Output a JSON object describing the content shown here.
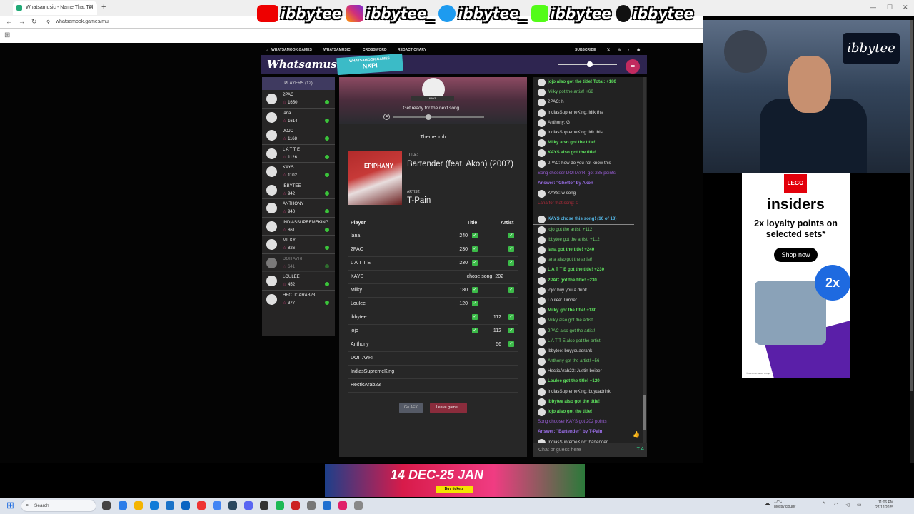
{
  "browser": {
    "tab_title": "Whatsamusic - Name That Tun",
    "url": "whatsamook.games/mu"
  },
  "overlay": {
    "handles": [
      "ibbytee",
      "ibbytee_",
      "ibbytee_",
      "ibbytee",
      "ibbytee"
    ],
    "cam_tag": "ibbytee"
  },
  "site": {
    "nav": [
      "WHATSAMOOK.GAMES",
      "WHATSAMUSIC",
      "CROSSWORD",
      "REDACTIONARY"
    ],
    "subscribe": "SUBSCRIBE",
    "logo": "Whatsamusic",
    "code_top": "WHATSAMOOK.GAMES",
    "code": "NXPI",
    "menu_icon": "hamburger-icon"
  },
  "players": {
    "header": "PLAYERS (12)",
    "list": [
      {
        "name": "2PAC",
        "score": "1650"
      },
      {
        "name": "lana",
        "score": "1614"
      },
      {
        "name": "JOJO",
        "score": "1168"
      },
      {
        "name": "L A T T E",
        "score": "1126"
      },
      {
        "name": "KAYS",
        "score": "1102"
      },
      {
        "name": "IBBYTEE",
        "score": "942"
      },
      {
        "name": "ANTHONY",
        "score": "940"
      },
      {
        "name": "INDIASSUPREMEKING",
        "score": "861"
      },
      {
        "name": "MILKY",
        "score": "826"
      },
      {
        "name": "DOITAYRI",
        "score": "641"
      },
      {
        "name": "LOULEE",
        "score": "452"
      },
      {
        "name": "HECTICARAB23",
        "score": "377"
      }
    ]
  },
  "game": {
    "chooser": "KAYS",
    "status": "Get ready for the next song...",
    "theme": "Theme: rnb",
    "title_label": "TITLE:",
    "title": "Bartender (feat. Akon) (2007)",
    "artist_label": "ARTIST:",
    "artist": "T-Pain",
    "cover_text": "EPIPHANY",
    "col_player": "Player",
    "col_title": "Title",
    "col_artist": "Artist",
    "rows": [
      {
        "player": "lana",
        "title": "240",
        "tcheck": true,
        "artist": "",
        "acheck": true,
        "note": ""
      },
      {
        "player": "2PAC",
        "title": "230",
        "tcheck": true,
        "artist": "",
        "acheck": true,
        "note": ""
      },
      {
        "player": "L A T T E",
        "title": "230",
        "tcheck": true,
        "artist": "",
        "acheck": true,
        "note": ""
      },
      {
        "player": "KAYS",
        "title": "",
        "tcheck": false,
        "artist": "",
        "acheck": false,
        "note": "chose song: 202"
      },
      {
        "player": "Milky",
        "title": "180",
        "tcheck": true,
        "artist": "",
        "acheck": true,
        "note": ""
      },
      {
        "player": "Loulee",
        "title": "120",
        "tcheck": true,
        "artist": "",
        "acheck": false,
        "note": ""
      },
      {
        "player": "ibbytee",
        "title": "",
        "tcheck": true,
        "artist": "112",
        "acheck": true,
        "note": ""
      },
      {
        "player": "jojo",
        "title": "",
        "tcheck": true,
        "artist": "112",
        "acheck": true,
        "note": ""
      },
      {
        "player": "Anthony",
        "title": "",
        "tcheck": false,
        "artist": "56",
        "acheck": true,
        "note": ""
      },
      {
        "player": "DOITAYRI",
        "title": "",
        "tcheck": false,
        "artist": "",
        "acheck": false,
        "note": ""
      },
      {
        "player": "IndiasSupremeKing",
        "title": "",
        "tcheck": false,
        "artist": "",
        "acheck": false,
        "note": ""
      },
      {
        "player": "HecticArab23",
        "title": "",
        "tcheck": false,
        "artist": "",
        "acheck": false,
        "note": ""
      }
    ],
    "afk_label": "Go AFK",
    "leave_label": "Leave game..."
  },
  "chat": {
    "messages": [
      {
        "t": "jojo also got the title! Total: +180",
        "k": "g",
        "av": true
      },
      {
        "t": "Milky got the artist! +68",
        "k": "gc",
        "av": true
      },
      {
        "t": "2PAC: h",
        "k": "",
        "av": true
      },
      {
        "t": "IndiasSupremeKing: idfk ths",
        "k": "",
        "av": true
      },
      {
        "t": "Anthony: G",
        "k": "",
        "av": true
      },
      {
        "t": "IndiasSupremeKing: idk this",
        "k": "",
        "av": true
      },
      {
        "t": "Milky also got the title!",
        "k": "g",
        "av": true
      },
      {
        "t": "KAYS also got the title!",
        "k": "g",
        "av": true
      },
      {
        "t": "2PAC: how do you not know this",
        "k": "",
        "av": true
      },
      {
        "t": "Song chooser DOITAYRI got 235 points",
        "k": "sys",
        "av": false
      },
      {
        "t": "Answer: \"Ghetto\" by Akon",
        "k": "ans",
        "av": false
      },
      {
        "t": "KAYS: w song",
        "k": "",
        "av": true
      },
      {
        "t": "Lana for that song: 0",
        "k": "red",
        "av": false
      },
      {
        "t": "",
        "k": "sp",
        "av": false
      },
      {
        "t": "KAYS chose this song! (10 of 13)",
        "k": "hl",
        "av": true
      },
      {
        "t": "jojo got the artist! +112",
        "k": "gc",
        "av": true
      },
      {
        "t": "ibbytee got the artist! +112",
        "k": "gc",
        "av": true
      },
      {
        "t": "lana got the title! +240",
        "k": "g",
        "av": true
      },
      {
        "t": "lana also got the artist!",
        "k": "gc",
        "av": true
      },
      {
        "t": "L A T T E got the title! +230",
        "k": "g",
        "av": true
      },
      {
        "t": "2PAC got the title! +230",
        "k": "g",
        "av": true
      },
      {
        "t": "jojo: buy you a drink",
        "k": "",
        "av": true
      },
      {
        "t": "Loulee: Timber",
        "k": "",
        "av": true
      },
      {
        "t": "Milky got the title! +180",
        "k": "g",
        "av": true
      },
      {
        "t": "Milky also got the artist!",
        "k": "gc",
        "av": true
      },
      {
        "t": "2PAC also got the artist!",
        "k": "gc",
        "av": true
      },
      {
        "t": "L A T T E also got the artist!",
        "k": "gc",
        "av": true
      },
      {
        "t": "ibbytee: buyyouadrank",
        "k": "",
        "av": true
      },
      {
        "t": "Anthony got the artist! +56",
        "k": "gc",
        "av": true
      },
      {
        "t": "HecticArab23: Justin beiber",
        "k": "",
        "av": true
      },
      {
        "t": "Loulee got the title! +120",
        "k": "g",
        "av": true
      },
      {
        "t": "IndiasSupremeKing: buyuadrink",
        "k": "",
        "av": true
      },
      {
        "t": "ibbytee also got the title!",
        "k": "g",
        "av": true
      },
      {
        "t": "jojo also got the title!",
        "k": "g",
        "av": true
      },
      {
        "t": "Song chooser KAYS got 202 points",
        "k": "sys",
        "av": false
      },
      {
        "t": "Answer: \"Bartender\" by T-Pain",
        "k": "ans",
        "av": false
      },
      {
        "t": "IndiasSupremeKing: bartender",
        "k": "",
        "av": true
      }
    ],
    "placeholder": "Chat or guess here"
  },
  "ads": {
    "lego": "LEGO",
    "insiders": "insiders",
    "offer": "2x loyalty points on selected sets*",
    "shop": "Shop now",
    "twox": "2x",
    "fine": "©2025 The LEGO Group",
    "bottom": "14 DEC-25 JAN",
    "tickets": "Buy tickets"
  },
  "taskbar": {
    "search": "Search",
    "weather_temp": "17°C",
    "weather_desc": "Mostly cloudy",
    "time": "11:06 PM",
    "date": "27/12/2025"
  },
  "colors": {
    "accent": "#3bbbc7",
    "correct": "#3bbb48",
    "leave": "#8a2c3c",
    "header": "#2e2550"
  }
}
